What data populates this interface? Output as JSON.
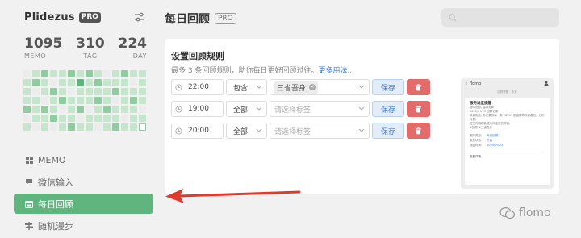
{
  "app": {
    "name": "Plidezus",
    "badge": "PRO",
    "stats": [
      {
        "value": "1095",
        "label": "MEMO"
      },
      {
        "value": "310",
        "label": "TAG"
      },
      {
        "value": "224",
        "label": "DAY"
      }
    ],
    "heatmap_levels": [
      0,
      1,
      1,
      1,
      2,
      0,
      1,
      1,
      2,
      0,
      1,
      1,
      1,
      0,
      2,
      1,
      1,
      0,
      2,
      1,
      1,
      1,
      0,
      2,
      1,
      1,
      2,
      0,
      1,
      1,
      1,
      2,
      0,
      1,
      1,
      2,
      1,
      0,
      1,
      1,
      1,
      2,
      1,
      3,
      1,
      1,
      2,
      0,
      1,
      2,
      1,
      1,
      1,
      0,
      1,
      1,
      1,
      2,
      1,
      2,
      1,
      1,
      0,
      0,
      1,
      1,
      1,
      2,
      1,
      1,
      1,
      1,
      2,
      0,
      1,
      1,
      2,
      2,
      1,
      1,
      1,
      1,
      0,
      1,
      1,
      0,
      1,
      2,
      1,
      1,
      1,
      1,
      1,
      1,
      1,
      0,
      1,
      4
    ],
    "colors": {
      "level0": "#ececec",
      "level1": "#c5e5cd",
      "level2": "#8fcc9f",
      "level3": "#5fb57d",
      "level4": "#ffffff",
      "accent": "#5fb57d"
    },
    "nav": [
      {
        "label": "MEMO",
        "icon": "grid-icon"
      },
      {
        "label": "微信输入",
        "icon": "chat-icon"
      },
      {
        "label": "每日回顾",
        "icon": "calendar-icon"
      },
      {
        "label": "随机漫步",
        "icon": "signpost-icon"
      }
    ]
  },
  "header": {
    "title": "每日回顾",
    "badge": "PRO",
    "search_placeholder": ""
  },
  "rules": {
    "title": "设置回顾规则",
    "desc": "最多 3 条回顾规则，助你每日更好回顾过往。",
    "more_link": "更多用法...",
    "rows": [
      {
        "time": "22:00",
        "mode": "包含",
        "tag": "三省吾身",
        "tag_placeholder": "",
        "save": "保存"
      },
      {
        "time": "19:00",
        "mode": "全部",
        "tag": "",
        "tag_placeholder": "请选择标签",
        "save": "保存"
      },
      {
        "time": "20:00",
        "mode": "全部",
        "tag": "",
        "tag_placeholder": "请选择标签",
        "save": "保存"
      }
    ]
  },
  "preview": {
    "app": "flomo",
    "subtitle": "回顾提醒 · 今天",
    "card_title": "服务进度提醒",
    "lines": [
      "及时回顾, 温故知新",
      "2020/09/23 回顾记录",
      "我们相信, 你记录的每一条 MEMO 都值得再次被看见，日积月累，",
      "这些内容都会成为你宝贵的财富。",
      "#回顾 #三省吾身"
    ],
    "kv": [
      {
        "k": "服务类型:",
        "v": "每日回顾"
      },
      {
        "k": "服务状态:",
        "v": "开启"
      },
      {
        "k": "提醒时间:",
        "v": "2020/09/23"
      }
    ],
    "footer": "查看详情"
  },
  "watermark": "flomo"
}
